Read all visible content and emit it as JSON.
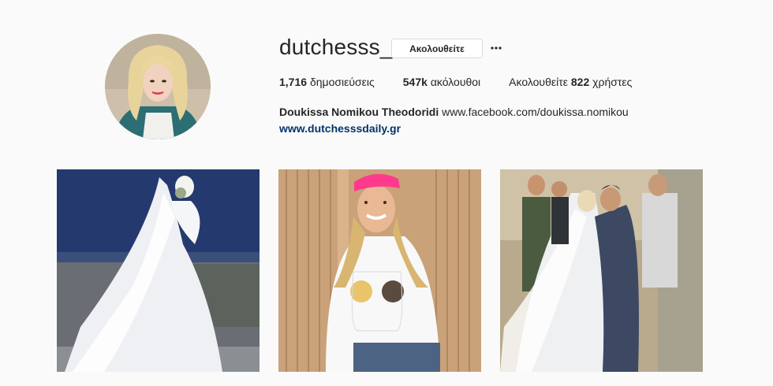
{
  "profile": {
    "username": "dutchesss_",
    "follow_label": "Ακολουθείτε",
    "more_icon": "ellipsis-icon",
    "avatar_alt": "profile-photo"
  },
  "stats": {
    "posts_count": "1,716",
    "posts_label": "δημοσιεύσεις",
    "followers_count": "547k",
    "followers_label": "ακόλουθοι",
    "following_prefix": "Ακολουθείτε",
    "following_count": "822",
    "following_suffix": "χρήστες"
  },
  "bio": {
    "full_name": "Doukissa Nomikou Theodoridi",
    "facebook": "www.facebook.com/doukissa.nomikou",
    "website": "www.dutchesssdaily.gr"
  },
  "posts": [
    {
      "subject": "bride-in-white-gown"
    },
    {
      "subject": "woman-pink-cap-tshirt"
    },
    {
      "subject": "wedding-kiss"
    }
  ],
  "colors": {
    "background": "#fafafa",
    "text": "#262626",
    "link": "#003569",
    "border": "#dbdbdb"
  }
}
